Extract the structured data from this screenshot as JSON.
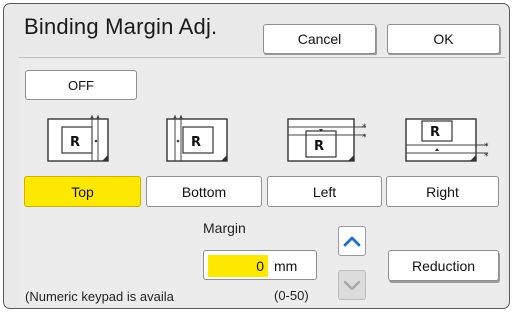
{
  "dialog": {
    "title": "Binding Margin Adj.",
    "cancel_label": "Cancel",
    "ok_label": "OK"
  },
  "off_label": "OFF",
  "positions": [
    {
      "label": "Top",
      "selected": true,
      "icon": "binding-top-icon"
    },
    {
      "label": "Bottom",
      "selected": false,
      "icon": "binding-bottom-icon"
    },
    {
      "label": "Left",
      "selected": false,
      "icon": "binding-left-icon"
    },
    {
      "label": "Right",
      "selected": false,
      "icon": "binding-right-icon"
    }
  ],
  "margin": {
    "label": "Margin",
    "value": "0",
    "unit": "mm",
    "range": "(0-50)"
  },
  "reduction_label": "Reduction",
  "hint": "(Numeric keypad is availa",
  "colors": {
    "selected": "#ffe800",
    "arrow": "#1f6fd0"
  }
}
